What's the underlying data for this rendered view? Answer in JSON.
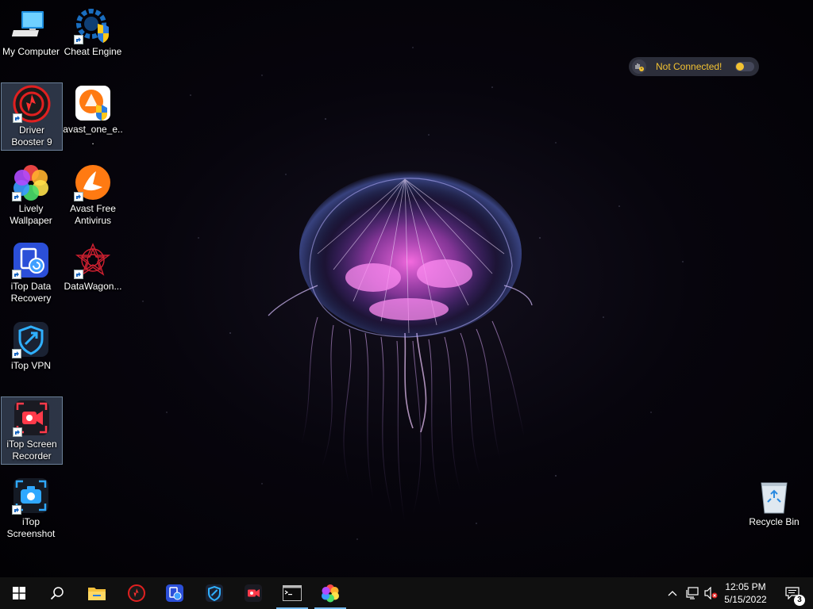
{
  "desktop": {
    "icons": [
      {
        "label": "My Computer",
        "icon": "computer-icon"
      },
      {
        "label": "Cheat Engine",
        "icon": "cheat-engine-icon"
      },
      {
        "label": "Driver Booster 9",
        "icon": "driver-booster-icon",
        "selected": true
      },
      {
        "label": "avast_one_e...",
        "icon": "avast-installer-icon"
      },
      {
        "label": "Lively Wallpaper",
        "icon": "lively-wallpaper-icon"
      },
      {
        "label": "Avast Free Antivirus",
        "icon": "avast-icon"
      },
      {
        "label": "iTop Data Recovery",
        "icon": "itop-data-recovery-icon"
      },
      {
        "label": "DataWagon...",
        "icon": "datawagon-icon"
      },
      {
        "label": "iTop VPN",
        "icon": "itop-vpn-icon"
      },
      {
        "label": "iTop Screen Recorder",
        "icon": "itop-screen-recorder-icon",
        "selected": true
      },
      {
        "label": "iTop Screenshot",
        "icon": "itop-screenshot-icon"
      },
      {
        "label": "Recycle Bin",
        "icon": "recycle-bin-icon"
      }
    ]
  },
  "vpn_widget": {
    "status": "Not Connected!",
    "status_color": "#f2c232"
  },
  "taskbar": {
    "buttons": [
      {
        "icon": "windows-start-icon"
      },
      {
        "icon": "search-icon"
      },
      {
        "icon": "file-explorer-icon"
      },
      {
        "icon": "driver-booster-icon"
      },
      {
        "icon": "itop-data-recovery-icon"
      },
      {
        "icon": "itop-vpn-icon"
      },
      {
        "icon": "itop-screen-recorder-icon"
      },
      {
        "icon": "command-prompt-icon",
        "active": true
      },
      {
        "icon": "lively-wallpaper-icon",
        "active": true
      }
    ],
    "tray": {
      "icons": [
        "chevron-up-icon",
        "network-icon",
        "volume-muted-icon"
      ],
      "time": "12:05 PM",
      "date": "5/15/2022",
      "notification_count": "3"
    },
    "accent": "#76b9ed"
  }
}
